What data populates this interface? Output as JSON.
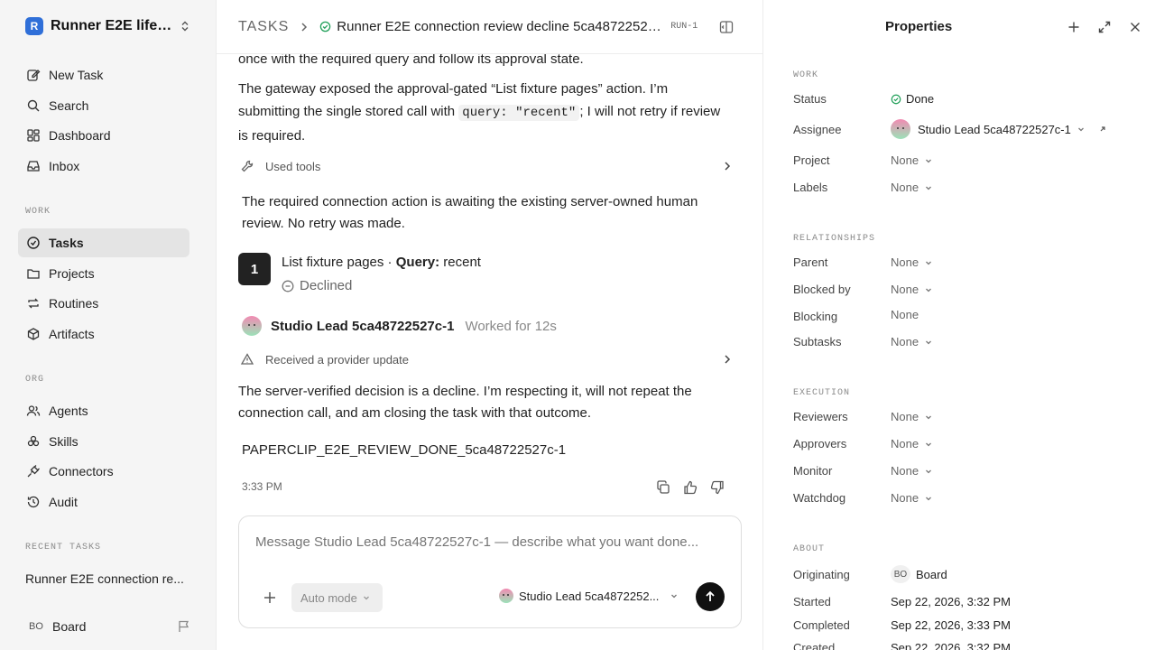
{
  "sidebar": {
    "workspace": {
      "logo": "R",
      "name": "Runner E2E lifecy..."
    },
    "primary": [
      {
        "label": "New Task",
        "icon": "pencil-square-icon"
      },
      {
        "label": "Search",
        "icon": "search-icon"
      },
      {
        "label": "Dashboard",
        "icon": "dashboard-icon"
      },
      {
        "label": "Inbox",
        "icon": "inbox-icon"
      }
    ],
    "work_label": "WORK",
    "work": [
      {
        "label": "Tasks",
        "icon": "check-circle-icon",
        "active": true
      },
      {
        "label": "Projects",
        "icon": "folder-icon"
      },
      {
        "label": "Routines",
        "icon": "repeat-icon"
      },
      {
        "label": "Artifacts",
        "icon": "cube-icon"
      }
    ],
    "org_label": "ORG",
    "org": [
      {
        "label": "Agents",
        "icon": "users-icon"
      },
      {
        "label": "Skills",
        "icon": "skills-icon"
      },
      {
        "label": "Connectors",
        "icon": "plug-icon"
      },
      {
        "label": "Audit",
        "icon": "history-icon"
      }
    ],
    "recent_label": "RECENT TASKS",
    "recent_task": "Runner E2E connection re...",
    "footer": {
      "initials": "BO",
      "name": "Board"
    }
  },
  "topbar": {
    "section": "TASKS",
    "title": "Runner E2E connection review decline 5ca48722527...",
    "task_id": "RUN-1"
  },
  "conversation": {
    "line_top": "once with the required query and follow its approval state.",
    "para1_a": "The gateway exposed the approval-gated “List fixture pages” action. I’m submitting the single stored call with ",
    "para1_code": "query: \"recent\"",
    "para1_b": "; I will not retry if review is required.",
    "used_tools": "Used tools",
    "para2": "The required connection action is awaiting the existing server-owned human review. No retry was made.",
    "approval": {
      "number": "1",
      "title": "List fixture pages · ",
      "query_label": "Query:",
      "query_value": " recent",
      "status": "Declined"
    },
    "agent": {
      "name": "Studio Lead 5ca48722527c-1",
      "worked": "Worked for 12s"
    },
    "provider_update": "Received a provider update",
    "para3": "The server-verified decision is a decline. I’m respecting it, will not repeat the connection call, and am closing the task with that outcome.",
    "done_token": "PAPERCLIP_E2E_REVIEW_DONE_5ca48722527c-1",
    "time": "3:33 PM"
  },
  "composer": {
    "placeholder": "Message Studio Lead 5ca48722527c-1 — describe what you want done...",
    "mode": "Auto mode",
    "agent": "Studio Lead 5ca4872252..."
  },
  "properties": {
    "title": "Properties",
    "work_label": "WORK",
    "status_label": "Status",
    "status_value": "Done",
    "assignee_label": "Assignee",
    "assignee_value": "Studio Lead 5ca48722527c-1",
    "project_label": "Project",
    "project_value": "None",
    "labels_label": "Labels",
    "labels_value": "None",
    "relationships_label": "RELATIONSHIPS",
    "parent_label": "Parent",
    "parent_value": "None",
    "blocked_by_label": "Blocked by",
    "blocked_by_value": "None",
    "blocking_label": "Blocking",
    "blocking_value": "None",
    "subtasks_label": "Subtasks",
    "subtasks_value": "None",
    "execution_label": "EXECUTION",
    "reviewers_label": "Reviewers",
    "reviewers_value": "None",
    "approvers_label": "Approvers",
    "approvers_value": "None",
    "monitor_label": "Monitor",
    "monitor_value": "None",
    "watchdog_label": "Watchdog",
    "watchdog_value": "None",
    "about_label": "ABOUT",
    "originating_label": "Originating",
    "originating_initials": "BO",
    "originating_value": "Board",
    "started_label": "Started",
    "started_value": "Sep 22, 2026, 3:32 PM",
    "completed_label": "Completed",
    "completed_value": "Sep 22, 2026, 3:33 PM",
    "created_label": "Created",
    "created_value": "Sep 22, 2026, 3:32 PM"
  },
  "colors": {
    "done_green": "#22a05a",
    "accent_logo": "#2f6fd8"
  }
}
